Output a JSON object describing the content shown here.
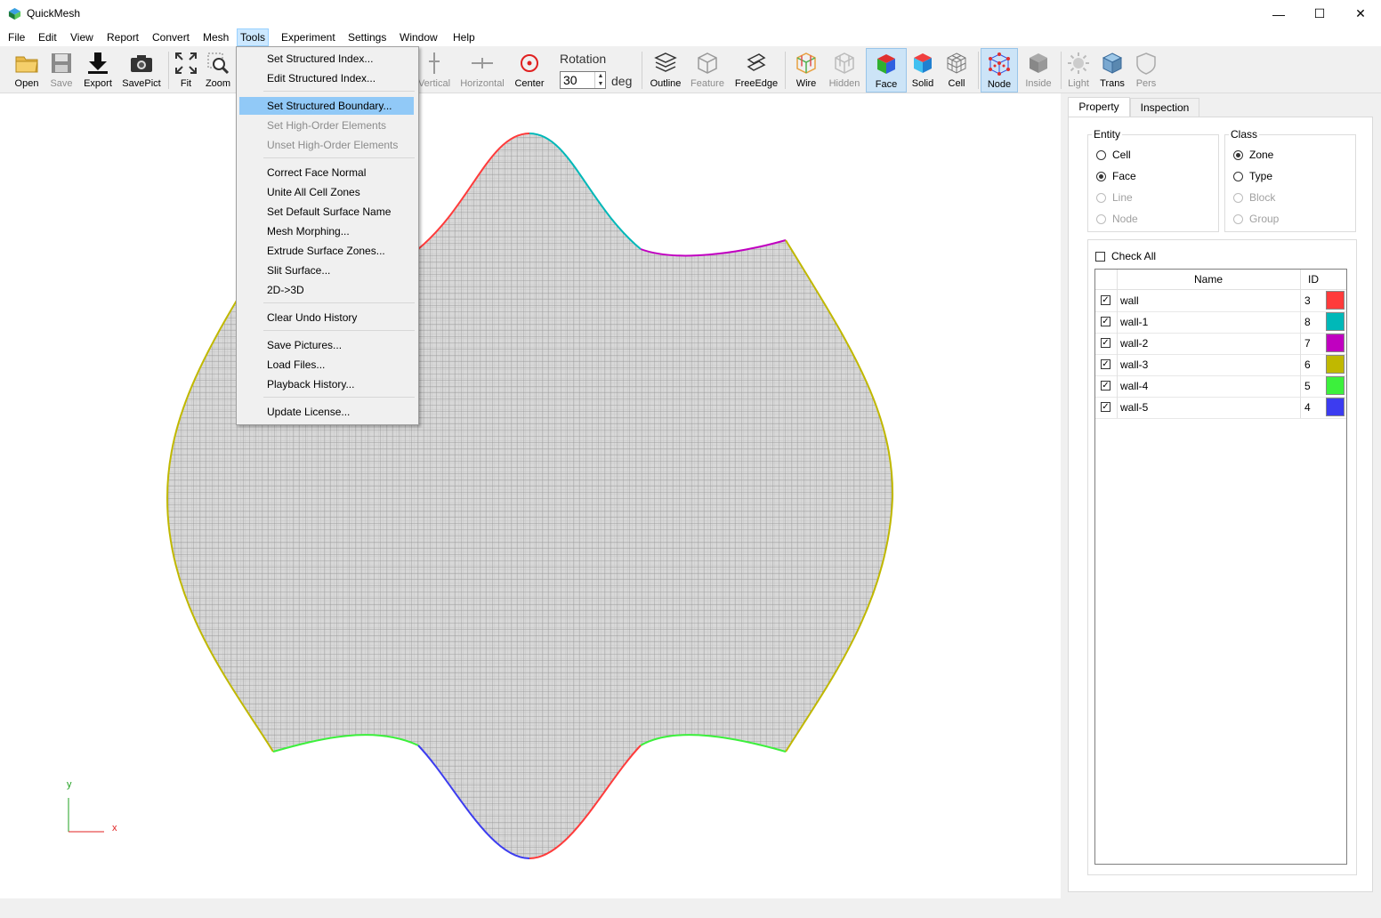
{
  "window": {
    "title": "QuickMesh",
    "controls": {
      "minimize": "—",
      "maximize": "☐",
      "close": "✕"
    }
  },
  "menubar": {
    "items": [
      "File",
      "Edit",
      "View",
      "Report",
      "Convert",
      "Mesh",
      "Tools",
      "Experiment",
      "Settings",
      "Window",
      "Help"
    ],
    "open_menu": "Tools"
  },
  "toolbar": {
    "open": "Open",
    "save": "Save",
    "export": "Export",
    "savepict": "SavePict",
    "fit": "Fit",
    "zoom": "Zoom",
    "vertical": "Vertical",
    "horizontal": "Horizontal",
    "center": "Center",
    "outline": "Outline",
    "feature": "Feature",
    "freeedge": "FreeEdge",
    "wire": "Wire",
    "hidden": "Hidden",
    "face": "Face",
    "solid": "Solid",
    "cell": "Cell",
    "node": "Node",
    "inside": "Inside",
    "light": "Light",
    "trans": "Trans",
    "pers": "Pers"
  },
  "rotation": {
    "label": "Rotation",
    "value": "30",
    "unit": "deg"
  },
  "tools_menu": {
    "items": [
      {
        "label": "Set Structured Index...",
        "enabled": true
      },
      {
        "label": "Edit Structured Index...",
        "enabled": true
      },
      {
        "label": "Set Structured Boundary...",
        "enabled": true,
        "highlighted": true
      },
      {
        "label": "Set High-Order Elements",
        "enabled": false
      },
      {
        "label": "Unset High-Order Elements",
        "enabled": false
      },
      {
        "label": "Correct Face Normal",
        "enabled": true
      },
      {
        "label": "Unite All Cell Zones",
        "enabled": true
      },
      {
        "label": "Set Default Surface Name",
        "enabled": true
      },
      {
        "label": "Mesh Morphing...",
        "enabled": true
      },
      {
        "label": "Extrude Surface Zones...",
        "enabled": true
      },
      {
        "label": "Slit Surface...",
        "enabled": true
      },
      {
        "label": "2D->3D",
        "enabled": true
      },
      {
        "label": "Clear Undo History",
        "enabled": true
      },
      {
        "label": "Save Pictures...",
        "enabled": true
      },
      {
        "label": "Load Files...",
        "enabled": true
      },
      {
        "label": "Playback History...",
        "enabled": true
      },
      {
        "label": "Update License...",
        "enabled": true
      }
    ]
  },
  "panel": {
    "tabs": [
      "Property",
      "Inspection"
    ],
    "active_tab": "Property",
    "entity": {
      "title": "Entity",
      "options": [
        {
          "label": "Cell",
          "checked": false,
          "enabled": true
        },
        {
          "label": "Face",
          "checked": true,
          "enabled": true
        },
        {
          "label": "Line",
          "checked": false,
          "enabled": false
        },
        {
          "label": "Node",
          "checked": false,
          "enabled": false
        }
      ]
    },
    "class": {
      "title": "Class",
      "options": [
        {
          "label": "Zone",
          "checked": true,
          "enabled": true
        },
        {
          "label": "Type",
          "checked": false,
          "enabled": true
        },
        {
          "label": "Block",
          "checked": false,
          "enabled": false
        },
        {
          "label": "Group",
          "checked": false,
          "enabled": false
        }
      ]
    },
    "check_all": "Check All",
    "table": {
      "headers": {
        "name": "Name",
        "id": "ID"
      },
      "rows": [
        {
          "name": "wall",
          "id": "3",
          "color": "#ff3b3b",
          "checked": true
        },
        {
          "name": "wall-1",
          "id": "8",
          "color": "#00b8b8",
          "checked": true
        },
        {
          "name": "wall-2",
          "id": "7",
          "color": "#c000c0",
          "checked": true
        },
        {
          "name": "wall-3",
          "id": "6",
          "color": "#c0b800",
          "checked": true
        },
        {
          "name": "wall-4",
          "id": "5",
          "color": "#3cf03c",
          "checked": true
        },
        {
          "name": "wall-5",
          "id": "4",
          "color": "#3c3cf0",
          "checked": true
        }
      ]
    }
  },
  "viewport": {
    "axis_x": "x",
    "axis_y": "y",
    "boundary_colors": {
      "wall": "#ff3b3b",
      "wall-1": "#00b8b8",
      "wall-2": "#c000c0",
      "wall-3": "#c0b800",
      "wall-4": "#3cf03c",
      "wall-5": "#3c3cf0"
    }
  }
}
